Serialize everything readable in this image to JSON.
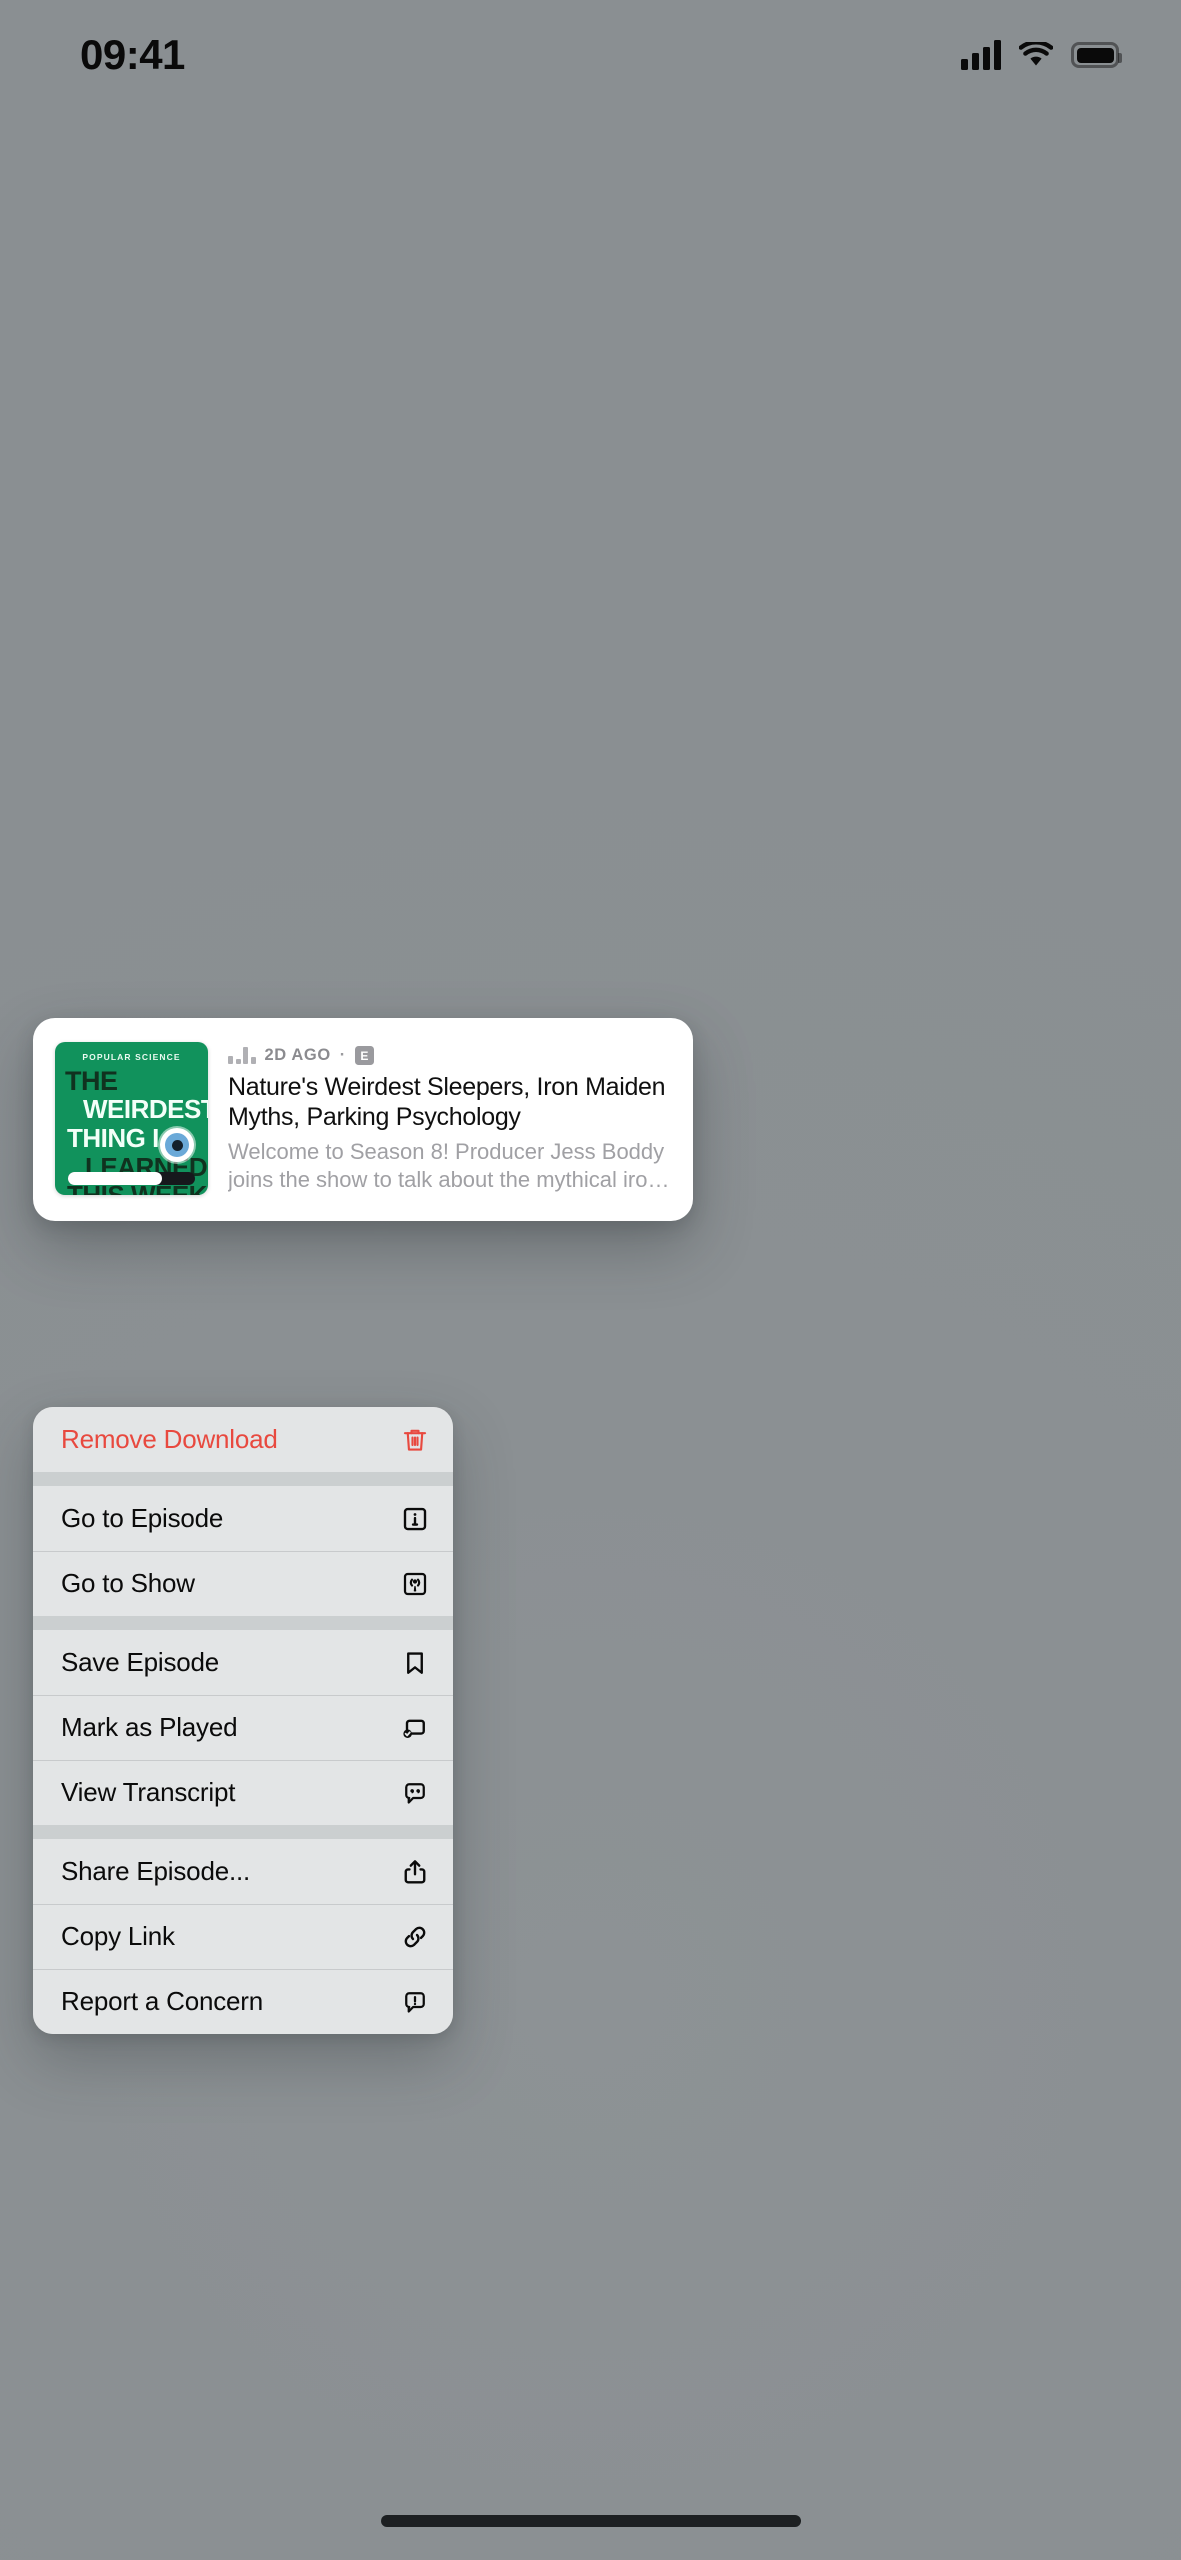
{
  "status_bar": {
    "time": "09:41",
    "cellular_icon": "signal-bars-icon",
    "wifi_icon": "wifi-icon",
    "battery_icon": "battery-full-icon"
  },
  "episode_card": {
    "artwork": {
      "icon": "podcast-artwork",
      "brand": "POPULAR SCIENCE",
      "line1": "THE",
      "line2": "WEIRDEST",
      "line3": "THING I",
      "line4": "LEARNED",
      "line5": "THIS WEEK",
      "background_color": "#11925c",
      "progress_percent": 74
    },
    "meta": {
      "equalizer_icon": "equalizer-bars-icon",
      "time_ago": "2D AGO",
      "separator": "·",
      "explicit_badge": "E"
    },
    "title": "Nature's Weirdest Sleepers, Iron Maiden Myths, Parking Psychology",
    "description": "Welcome to Season 8! Producer Jess Boddy joins the show to talk about the mythical iron maiden..."
  },
  "context_menu": {
    "groups": [
      {
        "items": [
          {
            "label": "Remove Download",
            "icon": "trash-icon",
            "destructive": true
          }
        ]
      },
      {
        "items": [
          {
            "label": "Go to Episode",
            "icon": "info-square-icon",
            "destructive": false
          },
          {
            "label": "Go to Show",
            "icon": "podcast-square-icon",
            "destructive": false
          }
        ]
      },
      {
        "items": [
          {
            "label": "Save Episode",
            "icon": "bookmark-icon",
            "destructive": false
          },
          {
            "label": "Mark as Played",
            "icon": "mark-played-icon",
            "destructive": false
          },
          {
            "label": "View Transcript",
            "icon": "quote-bubble-icon",
            "destructive": false
          }
        ]
      },
      {
        "items": [
          {
            "label": "Share Episode...",
            "icon": "share-icon",
            "destructive": false
          },
          {
            "label": "Copy Link",
            "icon": "link-icon",
            "destructive": false
          },
          {
            "label": "Report a Concern",
            "icon": "exclamation-bubble-icon",
            "destructive": false
          }
        ]
      }
    ]
  },
  "colors": {
    "destructive": "#e8493f",
    "menu_background": "#e3e5e6",
    "artwork_green": "#11925c"
  },
  "home_indicator": {
    "icon": "home-indicator"
  }
}
